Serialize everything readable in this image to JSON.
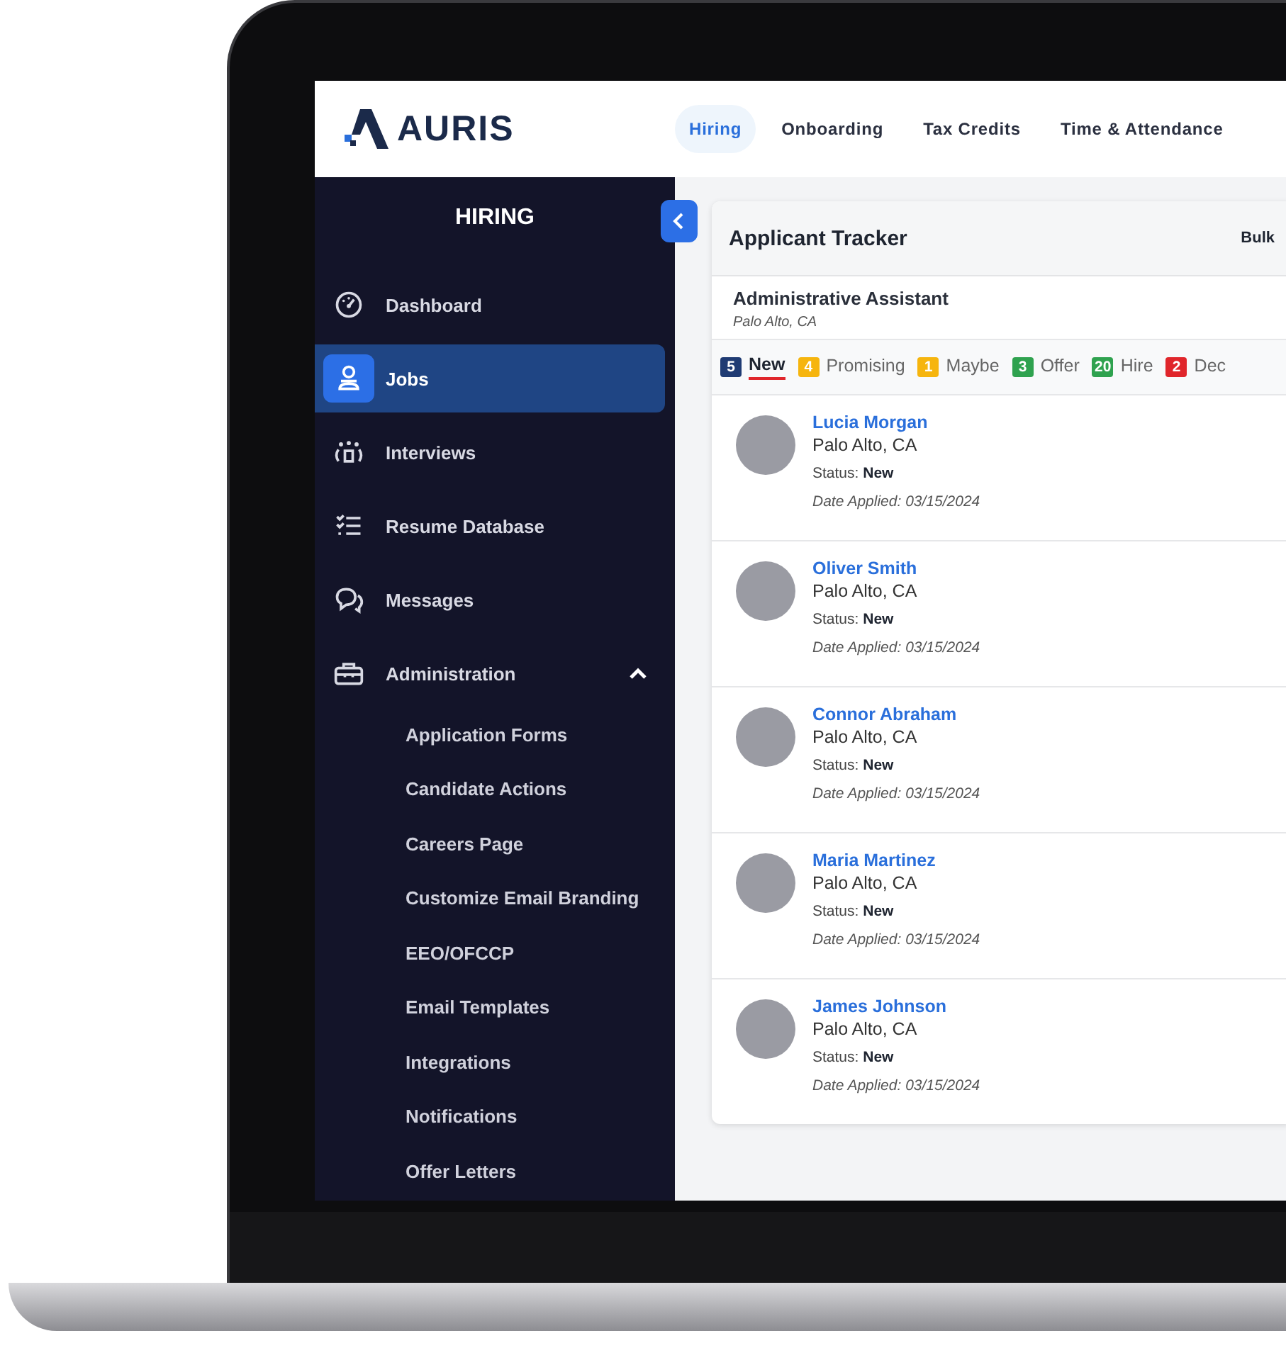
{
  "brand": {
    "name": "AURIS"
  },
  "nav_tabs": [
    {
      "label": "Hiring",
      "selected": true
    },
    {
      "label": "Onboarding",
      "selected": false
    },
    {
      "label": "Tax Credits",
      "selected": false
    },
    {
      "label": "Time & Attendance",
      "selected": false
    }
  ],
  "sidebar": {
    "title": "HIRING",
    "items": [
      {
        "label": "Dashboard",
        "selected": false
      },
      {
        "label": "Jobs",
        "selected": true
      },
      {
        "label": "Interviews",
        "selected": false
      },
      {
        "label": "Resume Database",
        "selected": false
      },
      {
        "label": "Messages",
        "selected": false
      },
      {
        "label": "Administration",
        "selected": false,
        "expanded": true,
        "children": [
          {
            "label": "Application Forms"
          },
          {
            "label": "Candidate Actions"
          },
          {
            "label": "Careers Page"
          },
          {
            "label": "Customize Email Branding"
          },
          {
            "label": "EEO/OFCCP"
          },
          {
            "label": "Email Templates"
          },
          {
            "label": "Integrations"
          },
          {
            "label": "Notifications"
          },
          {
            "label": "Offer Letters"
          }
        ]
      }
    ]
  },
  "tracker": {
    "title": "Applicant Tracker",
    "action": "Bulk",
    "job": {
      "title": "Administrative Assistant",
      "location": "Palo Alto, CA"
    },
    "stages": [
      {
        "count": "5",
        "label": "New",
        "color": "#1f3b73",
        "selected": true
      },
      {
        "count": "4",
        "label": "Promising",
        "color": "#f6b50e",
        "selected": false
      },
      {
        "count": "1",
        "label": "Maybe",
        "color": "#f6b50e",
        "selected": false
      },
      {
        "count": "3",
        "label": "Offer",
        "color": "#2fa24f",
        "selected": false
      },
      {
        "count": "20",
        "label": "Hire",
        "color": "#2fa24f",
        "selected": false
      },
      {
        "count": "2",
        "label": "Dec",
        "color": "#e0262b",
        "selected": false
      }
    ],
    "applicants": [
      {
        "name": "Lucia Morgan",
        "location": "Palo Alto, CA",
        "status": "Status: **New**",
        "date": "Date Applied: 03/15/2024"
      },
      {
        "name": "Oliver Smith",
        "location": "Palo Alto, CA",
        "status": "Status: **New**",
        "date": "Date Applied: 03/15/2024"
      },
      {
        "name": "Connor Abraham",
        "location": "Palo Alto, CA",
        "status": "Status: **New**",
        "date": "Date Applied: 03/15/2024"
      },
      {
        "name": "Maria Martinez",
        "location": "Palo Alto, CA",
        "status": "Status: **New**",
        "date": "Date Applied: 03/15/2024"
      },
      {
        "name": "James Johnson",
        "location": "Palo Alto, CA",
        "status": "Status: **New**",
        "date": "Date Applied: 03/15/2024"
      }
    ]
  }
}
